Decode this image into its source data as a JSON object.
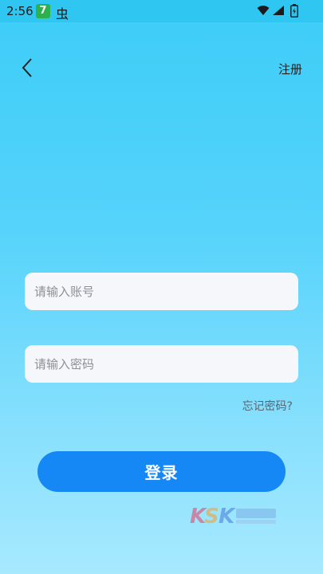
{
  "status_bar": {
    "time": "2:56",
    "badge_text": "7",
    "bug_glyph": "虫",
    "icons": [
      "wifi-icon",
      "signal-icon",
      "battery-icon"
    ]
  },
  "nav": {
    "back_icon": "chevron-left-icon",
    "register_label": "注册"
  },
  "form": {
    "account_placeholder": "请输入账号",
    "account_value": "",
    "password_placeholder": "请输入密码",
    "password_value": "",
    "forgot_label": "忘记密码?",
    "login_label": "登录"
  },
  "colors": {
    "background_top": "#3ccdf7",
    "background_bottom": "#a7e9ff",
    "primary_button": "#1688f5",
    "input_background": "#f6f7fa",
    "status_badge": "#2bb24c"
  }
}
